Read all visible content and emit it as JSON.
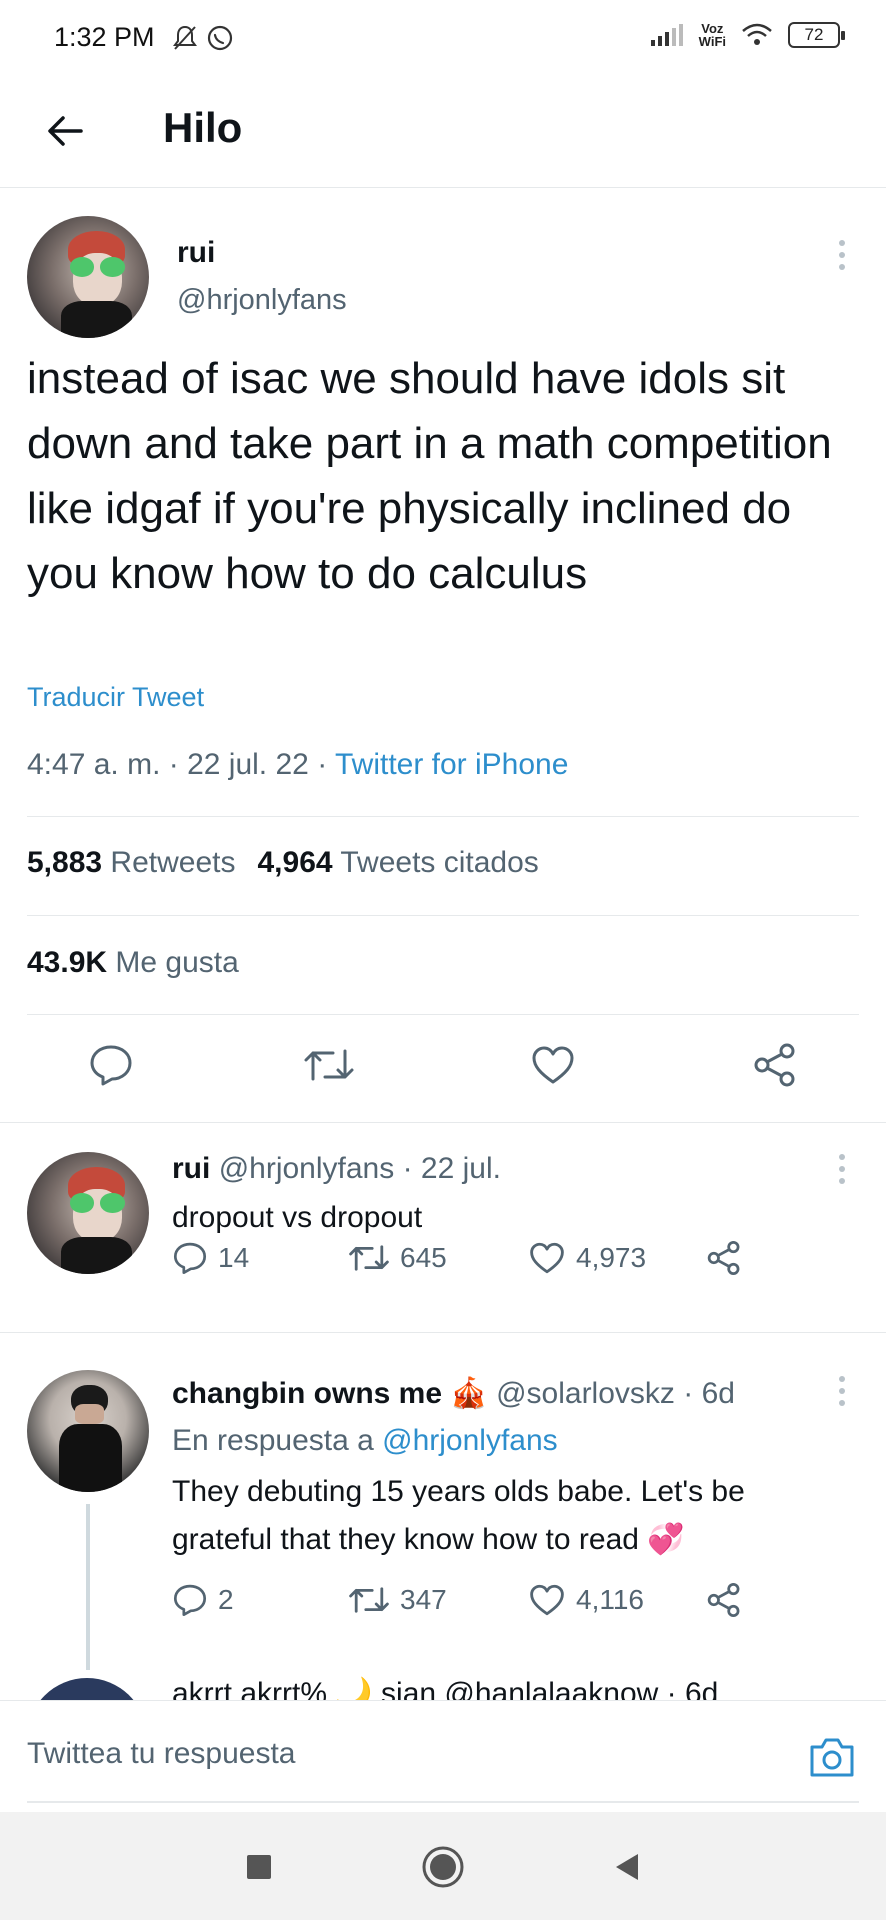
{
  "status_bar": {
    "time": "1:32 PM",
    "network": "Voz WiFi",
    "network_line1": "Voz",
    "network_line2": "WiFi",
    "battery": "72"
  },
  "header": {
    "title": "Hilo",
    "back_icon": "arrow-left-icon"
  },
  "main_tweet": {
    "name": "rui",
    "handle": "@hrjonlyfans",
    "text": "instead of isac we should have idols sit down and take part in a math competition like idgaf if you're physically inclined do you know how to do calculus",
    "translate_label": "Traducir Tweet",
    "time": "4:47 a. m.",
    "date": "22 jul. 22",
    "source": "Twitter for iPhone",
    "retweets_count": "5,883",
    "retweets_label": "Retweets",
    "quotes_count": "4,964",
    "quotes_label": "Tweets citados",
    "likes_count": "43.9K",
    "likes_label": "Me gusta"
  },
  "replies": [
    {
      "name": "rui",
      "handle": "@hrjonlyfans",
      "date": "· 22 jul.",
      "text": "dropout vs dropout",
      "replies": "14",
      "retweets": "645",
      "likes": "4,973"
    },
    {
      "name": "changbin owns me",
      "emoji": "🎪",
      "handle": "@solarlovskz",
      "date": "· 6d",
      "reply_to_label": "En respuesta a",
      "reply_to_handle": "@hrjonlyfans",
      "text": "They debuting 15 years olds babe. Let's be grateful that they know how to read",
      "text_emoji": "💞",
      "replies": "2",
      "retweets": "347",
      "likes": "4,116"
    }
  ],
  "partial_reply": {
    "text": "akrrt akrrt% 🌙 sian @hanlalaaknow · 6d"
  },
  "compose": {
    "placeholder": "Twittea tu respuesta"
  },
  "colors": {
    "link": "#2d8ecc",
    "secondary_text": "#536471",
    "divider": "#e6e9eb"
  }
}
